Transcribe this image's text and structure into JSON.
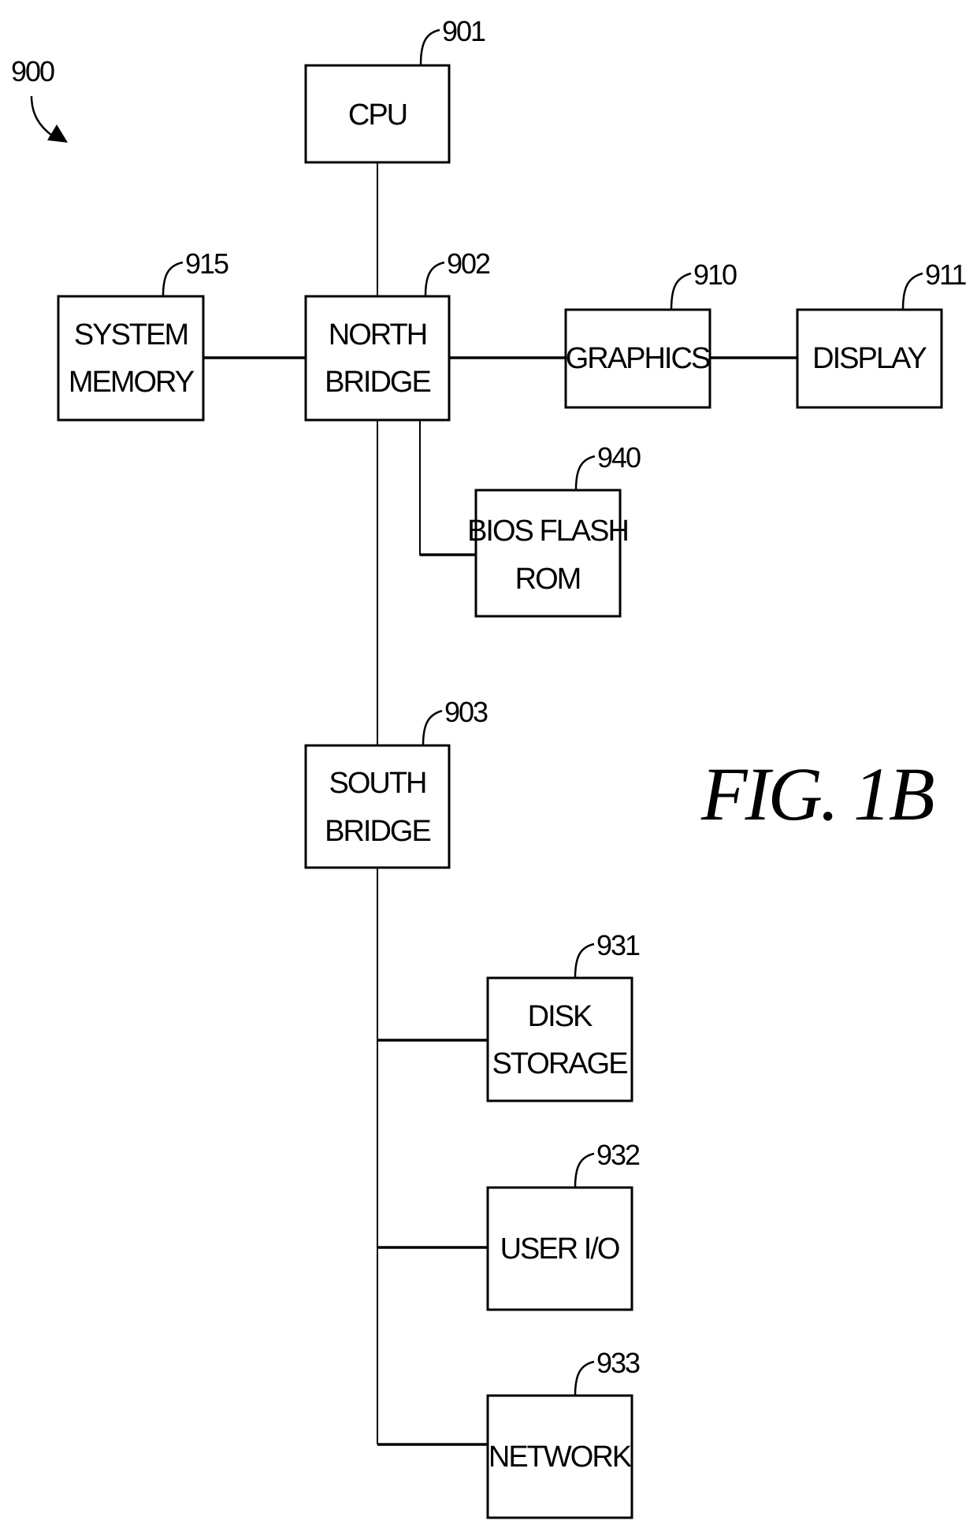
{
  "figure": {
    "title": "FIG. 1B",
    "reference": "900"
  },
  "blocks": {
    "cpu": {
      "ref": "901",
      "lines": [
        "CPU"
      ]
    },
    "north_bridge": {
      "ref": "902",
      "lines": [
        "NORTH",
        "BRIDGE"
      ]
    },
    "south_bridge": {
      "ref": "903",
      "lines": [
        "SOUTH",
        "BRIDGE"
      ]
    },
    "graphics": {
      "ref": "910",
      "lines": [
        "GRAPHICS"
      ]
    },
    "display": {
      "ref": "911",
      "lines": [
        "DISPLAY"
      ]
    },
    "system_memory": {
      "ref": "915",
      "lines": [
        "SYSTEM",
        "MEMORY"
      ]
    },
    "disk_storage": {
      "ref": "931",
      "lines": [
        "DISK",
        "STORAGE"
      ]
    },
    "user_io": {
      "ref": "932",
      "lines": [
        "USER I/O"
      ]
    },
    "network": {
      "ref": "933",
      "lines": [
        "NETWORK"
      ]
    },
    "bios_flash_rom": {
      "ref": "940",
      "lines": [
        "BIOS FLASH",
        "ROM"
      ]
    }
  },
  "connections": [
    [
      "cpu",
      "north_bridge"
    ],
    [
      "system_memory",
      "north_bridge"
    ],
    [
      "north_bridge",
      "graphics"
    ],
    [
      "graphics",
      "display"
    ],
    [
      "north_bridge",
      "bios_flash_rom"
    ],
    [
      "north_bridge",
      "south_bridge"
    ],
    [
      "south_bridge",
      "disk_storage"
    ],
    [
      "south_bridge",
      "user_io"
    ],
    [
      "south_bridge",
      "network"
    ]
  ]
}
